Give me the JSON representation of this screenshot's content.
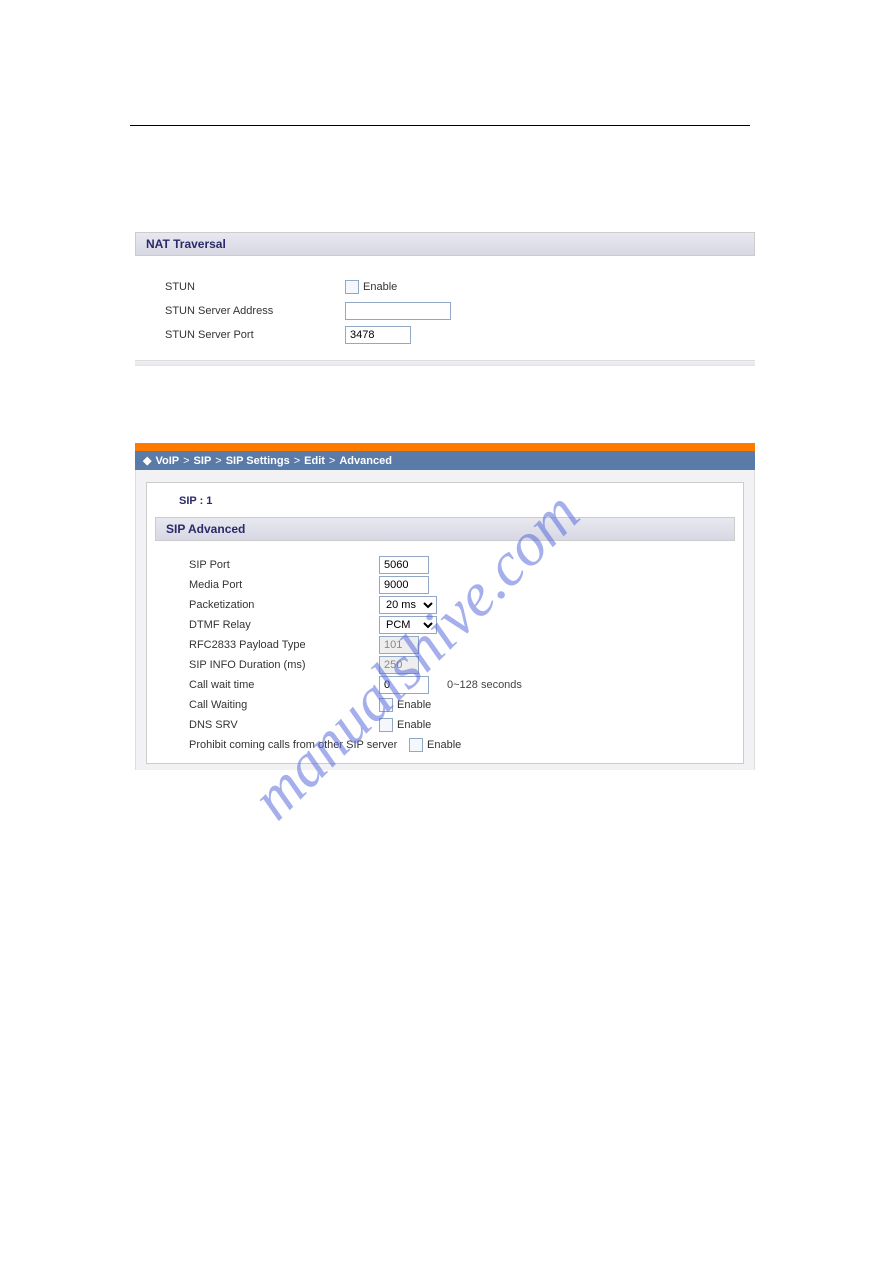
{
  "watermark": "manualshive.com",
  "nat": {
    "header": "NAT Traversal",
    "stun_label": "STUN",
    "stun_enable": "Enable",
    "stun_addr_label": "STUN Server Address",
    "stun_addr_value": "",
    "stun_port_label": "STUN Server Port",
    "stun_port_value": "3478"
  },
  "breadcrumb": {
    "bullet": "◆",
    "items": [
      "VoIP",
      "SIP",
      "SIP Settings",
      "Edit",
      "Advanced"
    ],
    "sep": ">"
  },
  "sip": {
    "title": "SIP : 1",
    "header": "SIP Advanced",
    "sip_port_label": "SIP Port",
    "sip_port_value": "5060",
    "media_port_label": "Media Port",
    "media_port_value": "9000",
    "packet_label": "Packetization",
    "packet_value": "20 ms",
    "dtmf_label": "DTMF Relay",
    "dtmf_value": "PCM",
    "rfc_label": "RFC2833 Payload Type",
    "rfc_value": "101",
    "info_label": "SIP INFO Duration (ms)",
    "info_value": "250",
    "wait_label": "Call wait time",
    "wait_value": "0",
    "wait_hint": "0~128 seconds",
    "callwait_label": "Call Waiting",
    "callwait_enable": "Enable",
    "dnssrv_label": "DNS SRV",
    "dnssrv_enable": "Enable",
    "prohibit_label": "Prohibit coming calls from other SIP server",
    "prohibit_enable": "Enable"
  }
}
